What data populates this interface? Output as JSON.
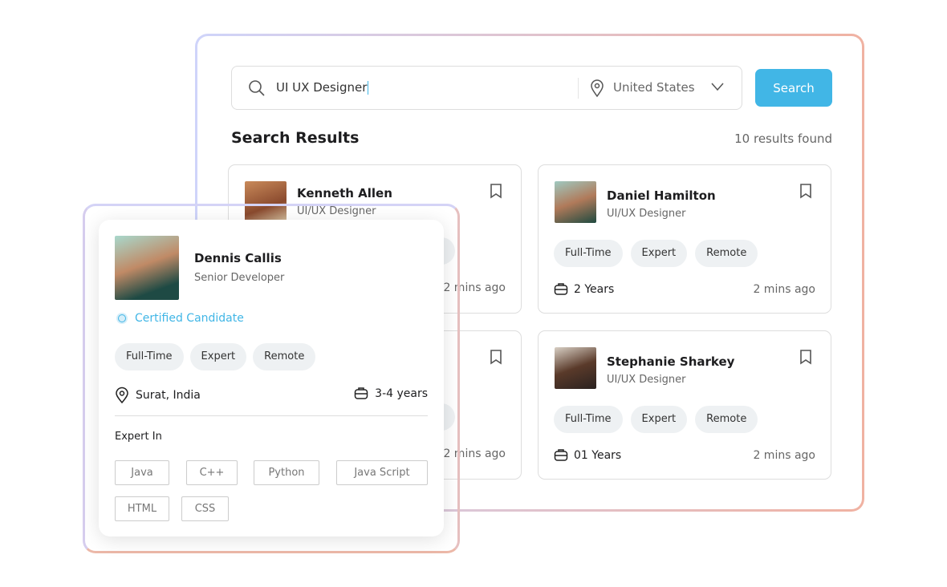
{
  "search": {
    "query": "UI UX Designer",
    "location": "United States",
    "button": "Search"
  },
  "results": {
    "title": "Search Results",
    "count": "10 results found"
  },
  "cards": [
    {
      "name": "Kenneth Allen",
      "role": "UI/UX Designer",
      "time": "2 mins ago"
    },
    {
      "name": "Daniel Hamilton",
      "role": "UI/UX Designer",
      "chips": [
        "Full-Time",
        "Expert",
        "Remote"
      ],
      "experience": "2 Years",
      "time": "2 mins ago"
    },
    {
      "time": "2 mins ago"
    },
    {
      "name": "Stephanie Sharkey",
      "role": "UI/UX Designer",
      "chips": [
        "Full-Time",
        "Expert",
        "Remote"
      ],
      "experience": "01 Years",
      "time": "2 mins ago"
    }
  ],
  "profile": {
    "name": "Dennis Callis",
    "role": "Senior Developer",
    "certified": "Certified Candidate",
    "chips": [
      "Full-Time",
      "Expert",
      "Remote"
    ],
    "location": "Surat, India",
    "experience": "3-4 years",
    "expert_label": "Expert In",
    "skills": [
      "Java",
      "C++",
      "Python",
      "Java Script",
      "HTML",
      "CSS"
    ]
  },
  "colors": {
    "accent": "#41b6e6",
    "chip_bg": "#eef1f3"
  }
}
